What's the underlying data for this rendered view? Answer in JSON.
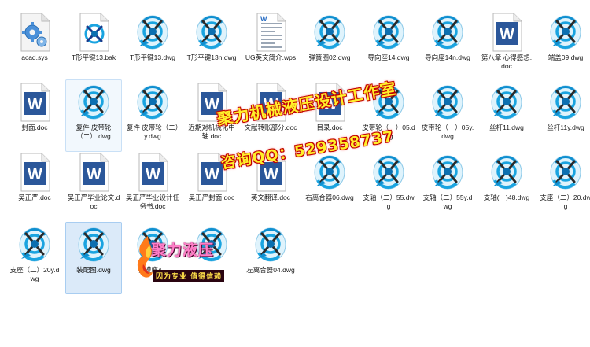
{
  "files": [
    {
      "name": "acad.sys",
      "type": "sys",
      "col": 0,
      "row": 0
    },
    {
      "name": "T形平键13.bak",
      "type": "bak",
      "col": 1,
      "row": 0
    },
    {
      "name": "T形平键13.dwg",
      "type": "dwg",
      "col": 2,
      "row": 0
    },
    {
      "name": "T形平键13n.dwg",
      "type": "dwg",
      "col": 3,
      "row": 0
    },
    {
      "name": "UG英文简介.wps",
      "type": "wps",
      "col": 4,
      "row": 0
    },
    {
      "name": "弹簧圈02.dwg",
      "type": "dwg",
      "col": 5,
      "row": 0
    },
    {
      "name": "导向座14.dwg",
      "type": "dwg",
      "col": 6,
      "row": 0
    },
    {
      "name": "导向座14n.dwg",
      "type": "dwg",
      "col": 7,
      "row": 0
    },
    {
      "name": "第八章 心得感想.doc",
      "type": "doc",
      "col": 8,
      "row": 0
    },
    {
      "name": "端盖09.dwg",
      "type": "dwg",
      "col": 9,
      "row": 0
    },
    {
      "name": "封面.doc",
      "type": "doc",
      "col": 0,
      "row": 1
    },
    {
      "name": "复件 皮带轮（二）.dwg",
      "type": "dwg",
      "col": 1,
      "row": 1,
      "state": "hov"
    },
    {
      "name": "复件 皮带轮（二）y.dwg",
      "type": "dwg",
      "col": 2,
      "row": 1
    },
    {
      "name": "近期对机械化中轴.doc",
      "type": "doc",
      "col": 3,
      "row": 1
    },
    {
      "name": "文献转账部分.doc",
      "type": "doc",
      "col": 4,
      "row": 1
    },
    {
      "name": "目录.doc",
      "type": "doc",
      "col": 5,
      "row": 1
    },
    {
      "name": "皮带轮（一）05.dwg",
      "type": "dwg",
      "col": 6,
      "row": 1
    },
    {
      "name": "皮带轮（一）05y.dwg",
      "type": "dwg",
      "col": 7,
      "row": 1
    },
    {
      "name": "丝杆11.dwg",
      "type": "dwg",
      "col": 8,
      "row": 1
    },
    {
      "name": "丝杆11y.dwg",
      "type": "dwg",
      "col": 9,
      "row": 1
    },
    {
      "name": "吴正严.doc",
      "type": "doc",
      "col": 0,
      "row": 2
    },
    {
      "name": "吴正严毕业论文.doc",
      "type": "doc",
      "col": 1,
      "row": 2
    },
    {
      "name": "吴正严毕业设计任务书.doc",
      "type": "doc",
      "col": 2,
      "row": 2
    },
    {
      "name": "吴正严封面.doc",
      "type": "doc",
      "col": 3,
      "row": 2
    },
    {
      "name": "英文翻译.doc",
      "type": "doc",
      "col": 4,
      "row": 2
    },
    {
      "name": "右离合器06.dwg",
      "type": "dwg",
      "col": 5,
      "row": 2
    },
    {
      "name": "支轴（二）55.dwg",
      "type": "dwg",
      "col": 6,
      "row": 2
    },
    {
      "name": "支轴（二）55y.dwg",
      "type": "dwg",
      "col": 7,
      "row": 2
    },
    {
      "name": "支轴(一)48.dwg",
      "type": "dwg",
      "col": 8,
      "row": 2
    },
    {
      "name": "支座（二）20.dwg",
      "type": "dwg",
      "col": 9,
      "row": 2
    },
    {
      "name": "支座（二）20y.dwg",
      "type": "dwg",
      "col": 0,
      "row": 3
    },
    {
      "name": "装配图.dwg",
      "type": "dwg",
      "col": 1,
      "row": 3,
      "state": "sel"
    },
    {
      "name": "钻模座4...",
      "type": "dwg",
      "col": 2,
      "row": 3
    },
    {
      "name": "...",
      "type": "dwg",
      "col": 3,
      "row": 3
    },
    {
      "name": "左离合器04.dwg",
      "type": "dwg",
      "col": 4,
      "row": 3
    }
  ],
  "watermark": {
    "line1": "聚力机械液压设计工作室",
    "line2": "咨询QQ：529358737",
    "logo_title": "聚力液压",
    "logo_sub": "因为专业 值得信赖",
    "text_color": "#ffef2a",
    "outline_color": "#c00000"
  },
  "colors": {
    "word_blue": "#2b579a",
    "dwg_cyan": "#1aa4e0",
    "selection_bg": "#dbeaf9",
    "selection_border": "#a8cdf1"
  }
}
